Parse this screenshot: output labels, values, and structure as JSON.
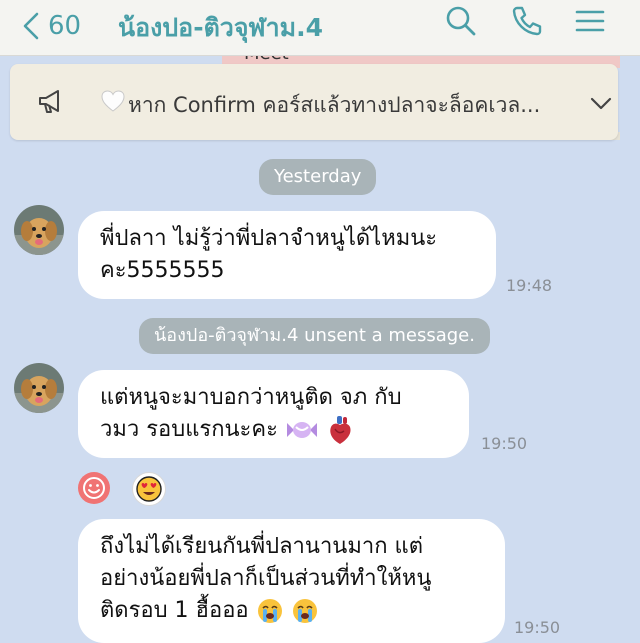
{
  "header": {
    "back_count": "60",
    "title": "น้องปอ-ติวจุฬาม.4",
    "accent": "#4a9fa8"
  },
  "peek_banner": {
    "text": "Meet"
  },
  "pinned": {
    "text": "หาก Confirm คอร์สแล้วทางปลาจะล็อคเวล...",
    "icon": "megaphone-icon"
  },
  "date_pill": "Yesterday",
  "system_notice": "น้องปอ-ติวจุฬาม.4 unsent a message.",
  "messages": [
    {
      "lines": [
        "พี่ปลาา ไม่รู้ว่าพี่ปลาจำหนูได้ไหมนะ",
        "คะ5555555"
      ],
      "time": "19:48"
    },
    {
      "lines": [
        "แต่หนูจะมาบอกว่าหนูติด จภ กับ",
        "วมว รอบแรกนะคะ"
      ],
      "time": "19:50"
    },
    {
      "lines": [
        "ถึงไม่ได้เรียนกันพี่ปลานานมาก แต่",
        "อย่างน้อยพี่ปลาก็เป็นส่วนที่ทำให้หนู",
        "ติดรอบ 1 ฮื้อออ"
      ],
      "time": "19:50"
    }
  ],
  "colors": {
    "background": "#cfdcf0",
    "bubble": "#ffffff",
    "pill": "#a9b4b8"
  }
}
